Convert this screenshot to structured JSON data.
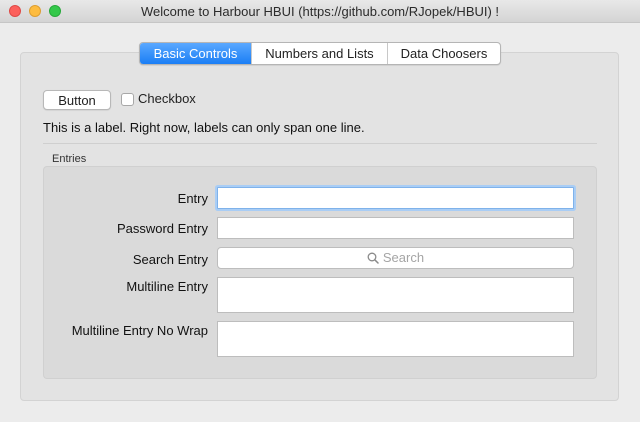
{
  "window": {
    "title": "Welcome to Harbour HBUI (https://github.com/RJopek/HBUI) !"
  },
  "tabs": [
    {
      "label": "Basic Controls",
      "active": true
    },
    {
      "label": "Numbers and Lists",
      "active": false
    },
    {
      "label": "Data Choosers",
      "active": false
    }
  ],
  "controls": {
    "button_label": "Button",
    "checkbox_label": "Checkbox",
    "checkbox_checked": false,
    "label_text": "This is a label. Right now, labels can only span one line."
  },
  "entries": {
    "group_title": "Entries",
    "entry_label": "Entry",
    "entry_value": "",
    "password_label": "Password Entry",
    "password_value": "",
    "search_label": "Search Entry",
    "search_placeholder": "Search",
    "multiline_label": "Multiline Entry",
    "multiline_value": "",
    "multiline_nowrap_label": "Multiline Entry No Wrap",
    "multiline_nowrap_value": ""
  },
  "colors": {
    "accent": "#1a7ef5",
    "focus_ring": "#a9cdf5",
    "close": "#fc605c",
    "minimize": "#fdbc40",
    "maximize": "#34c84a"
  }
}
